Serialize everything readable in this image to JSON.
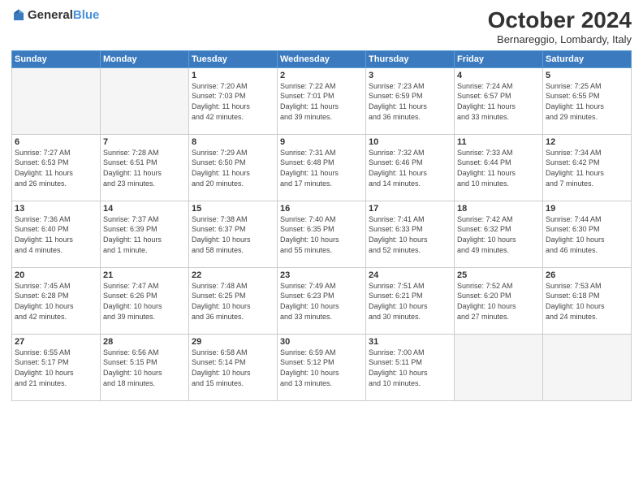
{
  "header": {
    "logo_general": "General",
    "logo_blue": "Blue",
    "month_title": "October 2024",
    "location": "Bernareggio, Lombardy, Italy"
  },
  "days_of_week": [
    "Sunday",
    "Monday",
    "Tuesday",
    "Wednesday",
    "Thursday",
    "Friday",
    "Saturday"
  ],
  "weeks": [
    [
      {
        "day": "",
        "info": ""
      },
      {
        "day": "",
        "info": ""
      },
      {
        "day": "1",
        "info": "Sunrise: 7:20 AM\nSunset: 7:03 PM\nDaylight: 11 hours\nand 42 minutes."
      },
      {
        "day": "2",
        "info": "Sunrise: 7:22 AM\nSunset: 7:01 PM\nDaylight: 11 hours\nand 39 minutes."
      },
      {
        "day": "3",
        "info": "Sunrise: 7:23 AM\nSunset: 6:59 PM\nDaylight: 11 hours\nand 36 minutes."
      },
      {
        "day": "4",
        "info": "Sunrise: 7:24 AM\nSunset: 6:57 PM\nDaylight: 11 hours\nand 33 minutes."
      },
      {
        "day": "5",
        "info": "Sunrise: 7:25 AM\nSunset: 6:55 PM\nDaylight: 11 hours\nand 29 minutes."
      }
    ],
    [
      {
        "day": "6",
        "info": "Sunrise: 7:27 AM\nSunset: 6:53 PM\nDaylight: 11 hours\nand 26 minutes."
      },
      {
        "day": "7",
        "info": "Sunrise: 7:28 AM\nSunset: 6:51 PM\nDaylight: 11 hours\nand 23 minutes."
      },
      {
        "day": "8",
        "info": "Sunrise: 7:29 AM\nSunset: 6:50 PM\nDaylight: 11 hours\nand 20 minutes."
      },
      {
        "day": "9",
        "info": "Sunrise: 7:31 AM\nSunset: 6:48 PM\nDaylight: 11 hours\nand 17 minutes."
      },
      {
        "day": "10",
        "info": "Sunrise: 7:32 AM\nSunset: 6:46 PM\nDaylight: 11 hours\nand 14 minutes."
      },
      {
        "day": "11",
        "info": "Sunrise: 7:33 AM\nSunset: 6:44 PM\nDaylight: 11 hours\nand 10 minutes."
      },
      {
        "day": "12",
        "info": "Sunrise: 7:34 AM\nSunset: 6:42 PM\nDaylight: 11 hours\nand 7 minutes."
      }
    ],
    [
      {
        "day": "13",
        "info": "Sunrise: 7:36 AM\nSunset: 6:40 PM\nDaylight: 11 hours\nand 4 minutes."
      },
      {
        "day": "14",
        "info": "Sunrise: 7:37 AM\nSunset: 6:39 PM\nDaylight: 11 hours\nand 1 minute."
      },
      {
        "day": "15",
        "info": "Sunrise: 7:38 AM\nSunset: 6:37 PM\nDaylight: 10 hours\nand 58 minutes."
      },
      {
        "day": "16",
        "info": "Sunrise: 7:40 AM\nSunset: 6:35 PM\nDaylight: 10 hours\nand 55 minutes."
      },
      {
        "day": "17",
        "info": "Sunrise: 7:41 AM\nSunset: 6:33 PM\nDaylight: 10 hours\nand 52 minutes."
      },
      {
        "day": "18",
        "info": "Sunrise: 7:42 AM\nSunset: 6:32 PM\nDaylight: 10 hours\nand 49 minutes."
      },
      {
        "day": "19",
        "info": "Sunrise: 7:44 AM\nSunset: 6:30 PM\nDaylight: 10 hours\nand 46 minutes."
      }
    ],
    [
      {
        "day": "20",
        "info": "Sunrise: 7:45 AM\nSunset: 6:28 PM\nDaylight: 10 hours\nand 42 minutes."
      },
      {
        "day": "21",
        "info": "Sunrise: 7:47 AM\nSunset: 6:26 PM\nDaylight: 10 hours\nand 39 minutes."
      },
      {
        "day": "22",
        "info": "Sunrise: 7:48 AM\nSunset: 6:25 PM\nDaylight: 10 hours\nand 36 minutes."
      },
      {
        "day": "23",
        "info": "Sunrise: 7:49 AM\nSunset: 6:23 PM\nDaylight: 10 hours\nand 33 minutes."
      },
      {
        "day": "24",
        "info": "Sunrise: 7:51 AM\nSunset: 6:21 PM\nDaylight: 10 hours\nand 30 minutes."
      },
      {
        "day": "25",
        "info": "Sunrise: 7:52 AM\nSunset: 6:20 PM\nDaylight: 10 hours\nand 27 minutes."
      },
      {
        "day": "26",
        "info": "Sunrise: 7:53 AM\nSunset: 6:18 PM\nDaylight: 10 hours\nand 24 minutes."
      }
    ],
    [
      {
        "day": "27",
        "info": "Sunrise: 6:55 AM\nSunset: 5:17 PM\nDaylight: 10 hours\nand 21 minutes."
      },
      {
        "day": "28",
        "info": "Sunrise: 6:56 AM\nSunset: 5:15 PM\nDaylight: 10 hours\nand 18 minutes."
      },
      {
        "day": "29",
        "info": "Sunrise: 6:58 AM\nSunset: 5:14 PM\nDaylight: 10 hours\nand 15 minutes."
      },
      {
        "day": "30",
        "info": "Sunrise: 6:59 AM\nSunset: 5:12 PM\nDaylight: 10 hours\nand 13 minutes."
      },
      {
        "day": "31",
        "info": "Sunrise: 7:00 AM\nSunset: 5:11 PM\nDaylight: 10 hours\nand 10 minutes."
      },
      {
        "day": "",
        "info": ""
      },
      {
        "day": "",
        "info": ""
      }
    ]
  ]
}
